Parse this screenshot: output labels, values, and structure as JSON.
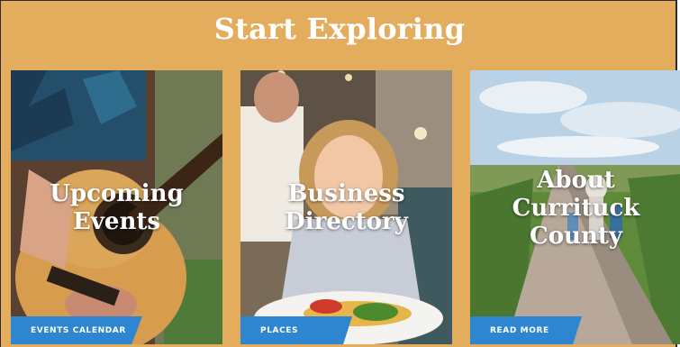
{
  "section": {
    "title": "Start Exploring"
  },
  "cards": [
    {
      "title_line1": "Upcoming",
      "title_line2": "Events",
      "cta": "EVENTS CALENDAR",
      "image": "guitar-player-photo"
    },
    {
      "title_line1": "Business",
      "title_line2": "Directory",
      "cta": "PLACES",
      "image": "girl-dining-photo"
    },
    {
      "title_line1": "About",
      "title_line2": "Currituck",
      "title_line3": "County",
      "cta": "READ MORE",
      "image": "boardwalk-marsh-photo"
    }
  ],
  "colors": {
    "background": "#e4ad5e",
    "button": "#2e86d0",
    "text": "#ffffff"
  }
}
